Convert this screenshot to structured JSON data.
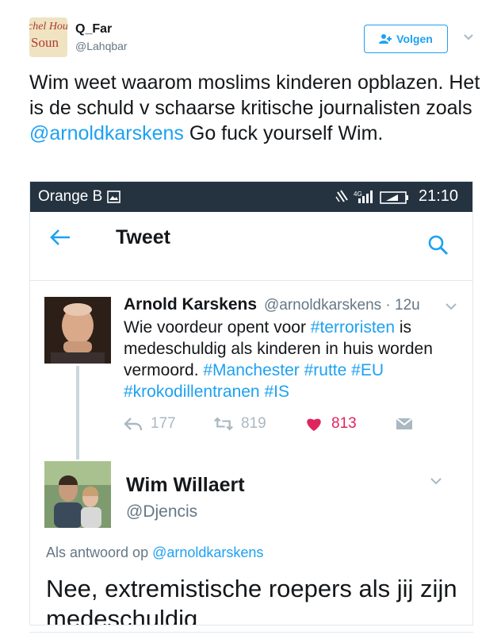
{
  "tweet": {
    "author_name": "Q_Far",
    "author_handle": "@Lahqbar",
    "avatar_text_line1": "chel Hou",
    "avatar_text_line2": "Soun",
    "follow_label": "Volgen",
    "text_before": "Wim weet waarom moslims kinderen opblazen. Het is de schuld v schaarse kritische journalisten zoals ",
    "text_mention": "@arnoldkarskens",
    "text_after": " Go fuck yourself Wim."
  },
  "screenshot": {
    "status_bar": {
      "carrier": "Orange B",
      "network": "4G",
      "time": "21:10"
    },
    "app_bar": {
      "title": "Tweet"
    },
    "quoted_tweet": {
      "name": "Arnold Karskens",
      "meta": "@arnoldkarskens · 12u",
      "text_parts": [
        {
          "t": "Wie voordeur opent voor ",
          "tag": false
        },
        {
          "t": "#terroristen",
          "tag": true
        },
        {
          "t": " is medeschuldig als kinderen in huis worden vermoord. ",
          "tag": false
        },
        {
          "t": "#Manchester",
          "tag": true
        },
        {
          "t": " ",
          "tag": false
        },
        {
          "t": "#rutte",
          "tag": true
        },
        {
          "t": " ",
          "tag": false
        },
        {
          "t": "#EU",
          "tag": true
        },
        {
          "t": " ",
          "tag": false
        },
        {
          "t": "#krokodillentranen",
          "tag": true
        },
        {
          "t": " ",
          "tag": false
        },
        {
          "t": "#IS",
          "tag": true
        }
      ],
      "replies": "177",
      "retweets": "819",
      "likes": "813"
    },
    "reply": {
      "name": "Wim Willaert",
      "handle": "@Djencis",
      "reply_label": "Als antwoord op ",
      "reply_mention": "@arnoldkarskens",
      "text": "Nee, extremistische roepers als jij zijn medeschuldig"
    }
  },
  "colors": {
    "accent": "#1da1f2",
    "like": "#e0245e",
    "status_bar": "#253341",
    "muted": "#657786"
  }
}
